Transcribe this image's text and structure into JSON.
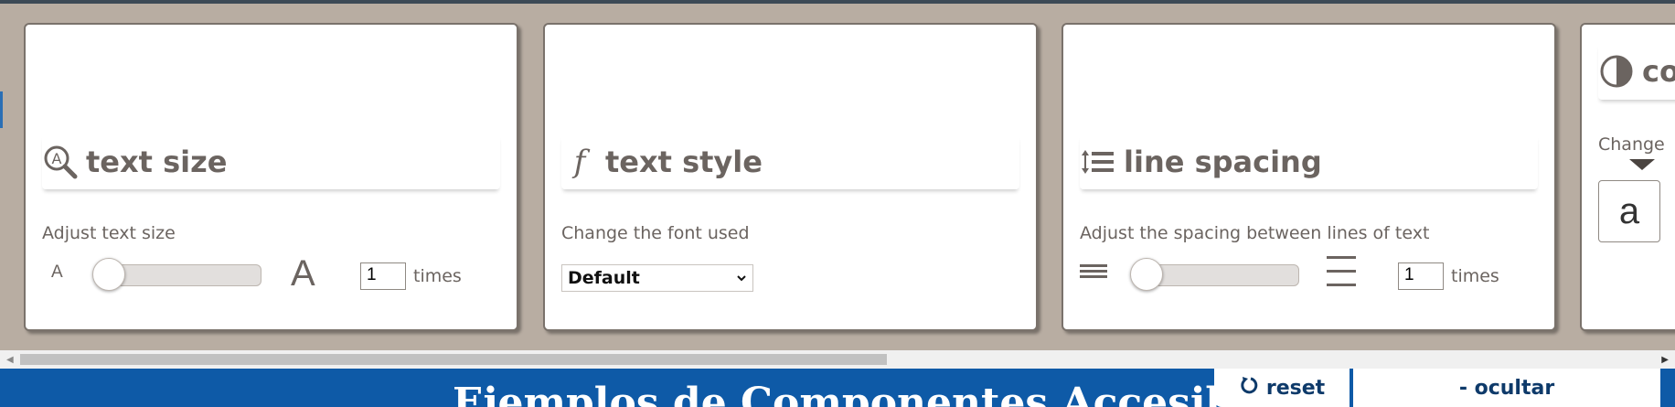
{
  "cards": {
    "text_size": {
      "title": "text size",
      "description": "Adjust text size",
      "small_glyph": "A",
      "large_glyph": "A",
      "value": "1",
      "unit": "times",
      "slider_level": 0
    },
    "text_style": {
      "title": "text style",
      "description": "Change the font used",
      "selected_font": "Default"
    },
    "line_spacing": {
      "title": "line spacing",
      "description": "Adjust the spacing between lines of text",
      "value": "1",
      "unit": "times",
      "slider_level": 0
    },
    "contrast": {
      "title": "co",
      "description": "Change",
      "sample_glyph": "a"
    }
  },
  "footer": {
    "banner_title": "Ejemplos de Componentes Accesibles",
    "reset_label": "reset",
    "hide_label": "- ocultar"
  },
  "icons": {
    "text_size": "magnifier-a-icon",
    "text_style": "italic-f-icon",
    "line_spacing": "line-spacing-icon",
    "contrast": "contrast-icon",
    "reset": "rotate-icon"
  }
}
